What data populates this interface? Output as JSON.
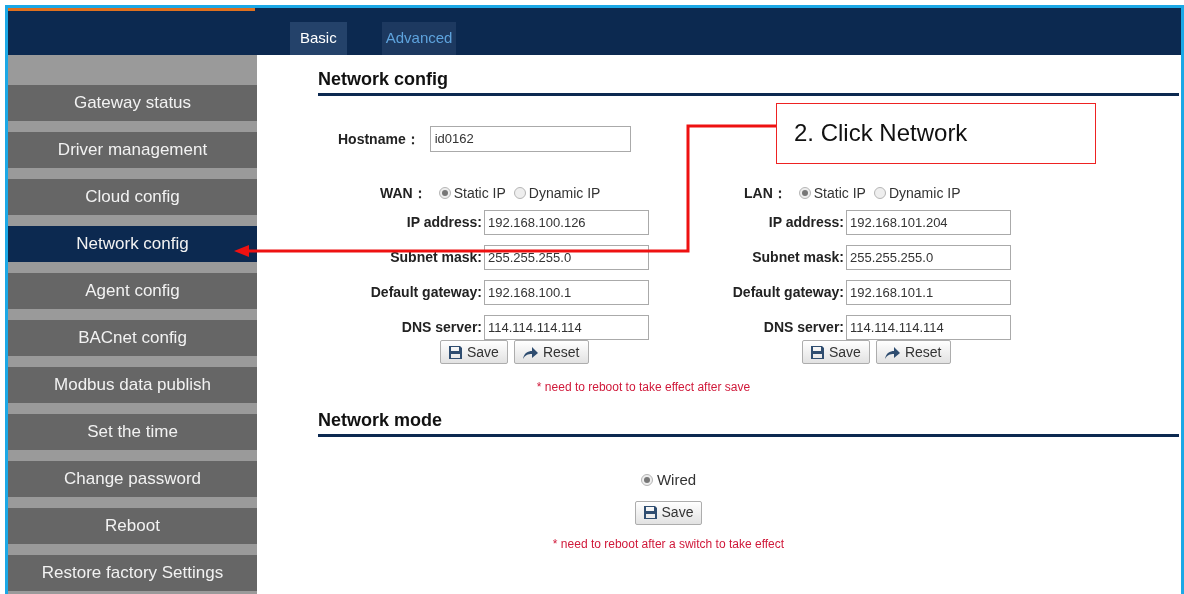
{
  "header": {
    "tabs": [
      {
        "label": "Basic",
        "selected": true
      },
      {
        "label": "Advanced",
        "selected": false
      }
    ]
  },
  "sidebar": {
    "items": [
      {
        "label": "Gateway status",
        "selected": false
      },
      {
        "label": "Driver management",
        "selected": false
      },
      {
        "label": "Cloud config",
        "selected": false
      },
      {
        "label": "Network config",
        "selected": true
      },
      {
        "label": "Agent config",
        "selected": false
      },
      {
        "label": "BACnet config",
        "selected": false
      },
      {
        "label": "Modbus data publish",
        "selected": false
      },
      {
        "label": "Set the time",
        "selected": false
      },
      {
        "label": "Change password",
        "selected": false
      },
      {
        "label": "Reboot",
        "selected": false
      },
      {
        "label": "Restore factory Settings",
        "selected": false
      }
    ]
  },
  "network_config": {
    "title": "Network config",
    "hostname": {
      "label": "Hostname：",
      "value": "id0162"
    },
    "interfaces": [
      {
        "label": "WAN：",
        "options": [
          {
            "label": "Static IP",
            "selected": true
          },
          {
            "label": "Dynamic IP",
            "selected": false
          }
        ],
        "fields": [
          {
            "label": "IP address:",
            "value": "192.168.100.126"
          },
          {
            "label": "Subnet mask:",
            "value": "255.255.255.0"
          },
          {
            "label": "Default gateway:",
            "value": "192.168.100.1"
          },
          {
            "label": "DNS server:",
            "value": "114.114.114.114"
          }
        ],
        "buttons": [
          {
            "kind": "save",
            "label": "Save"
          },
          {
            "kind": "reset",
            "label": "Reset"
          }
        ]
      },
      {
        "label": "LAN：",
        "options": [
          {
            "label": "Static IP",
            "selected": true
          },
          {
            "label": "Dynamic IP",
            "selected": false
          }
        ],
        "fields": [
          {
            "label": "IP address:",
            "value": "192.168.101.204"
          },
          {
            "label": "Subnet mask:",
            "value": "255.255.255.0"
          },
          {
            "label": "Default gateway:",
            "value": "192.168.101.1"
          },
          {
            "label": "DNS server:",
            "value": "114.114.114.114"
          }
        ],
        "buttons": [
          {
            "kind": "save",
            "label": "Save"
          },
          {
            "kind": "reset",
            "label": "Reset"
          }
        ]
      }
    ],
    "note": "* need to reboot to take effect after save"
  },
  "network_mode": {
    "title": "Network mode",
    "options": [
      {
        "label": "Wired",
        "selected": true
      }
    ],
    "buttons": [
      {
        "kind": "save",
        "label": "Save"
      }
    ],
    "note": "* need to reboot after a switch to take effect"
  },
  "callout": {
    "text": "2. Click Network"
  }
}
